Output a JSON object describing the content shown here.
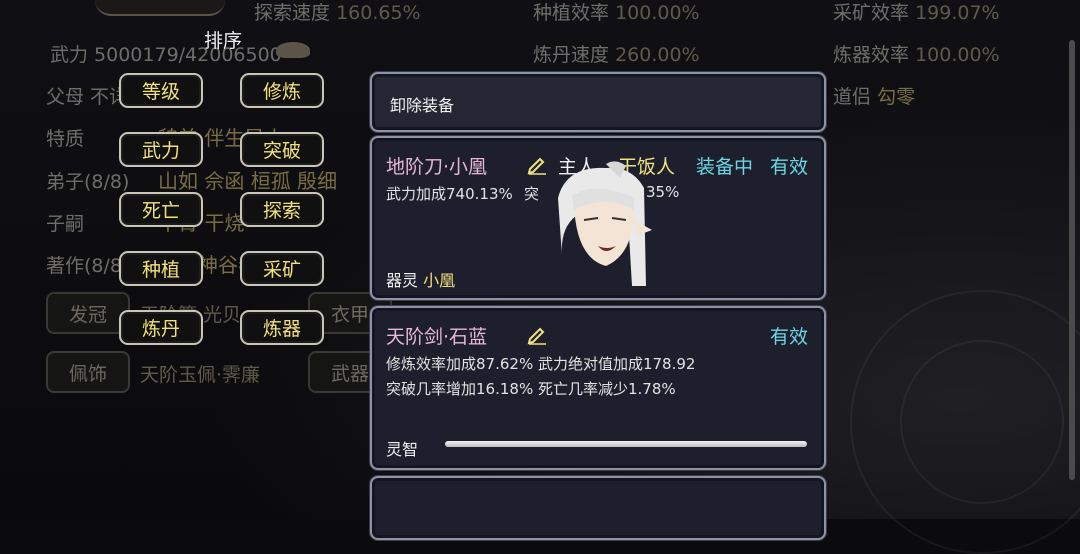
{
  "background": {
    "top_stats": [
      {
        "label": "探索速度",
        "value": "160.65%"
      },
      {
        "label": "种植效率",
        "value": "100.00%"
      },
      {
        "label": "采矿效率",
        "value": "199.07%"
      }
    ],
    "row2_stats": [
      {
        "label": "炼丹速度",
        "value": "260.00%"
      },
      {
        "label": "炼器效率",
        "value": "100.00%"
      }
    ],
    "power_text": "武力 5000179/42006500",
    "partner": {
      "label": "道侣",
      "value": "勾零"
    },
    "parents_label": "父母 不详",
    "trait_label": "特质",
    "trait_value": "貌美 伴生异火",
    "disciples_label": "弟子(8/8)",
    "disciples_value": "山如 佘函 桓孤 殷细",
    "heir_label": "子嗣",
    "heir_value": "平箐 干烧",
    "works_label": "著作(8/8)",
    "works_value": "木土神谷卷壹 火",
    "slot_crown": "发冠",
    "slot_crown_value": "天阶簪·光贝",
    "slot_armor": "衣甲",
    "slot_accessory": "佩饰",
    "slot_accessory_value": "天阶玉佩·霁廉",
    "slot_weapon": "武器"
  },
  "sort_menu": {
    "title": "排序",
    "buttons": [
      "等级",
      "修炼",
      "武力",
      "突破",
      "死亡",
      "探索",
      "种植",
      "采矿",
      "炼丹",
      "炼器"
    ]
  },
  "equip_panel": {
    "header": "卸除装备",
    "items": [
      {
        "name": "地阶刀·小凰",
        "owner_prefix": "主人",
        "owner_name": "干饭人",
        "equipped": "装备中",
        "status": "有效",
        "line1_left": "武力加成740.13%",
        "line1_mid": "突",
        "line1_right": "35%",
        "spirit_label": "器灵",
        "spirit_name": "小凰"
      },
      {
        "name": "天阶剑·石蓝",
        "status": "有效",
        "line1": "修炼效率加成87.62%  武力绝对值加成178.92",
        "line2": "突破几率增加16.18%  死亡几率减少1.78%",
        "wisdom_label": "灵智",
        "wisdom_progress": 1.0
      }
    ]
  }
}
